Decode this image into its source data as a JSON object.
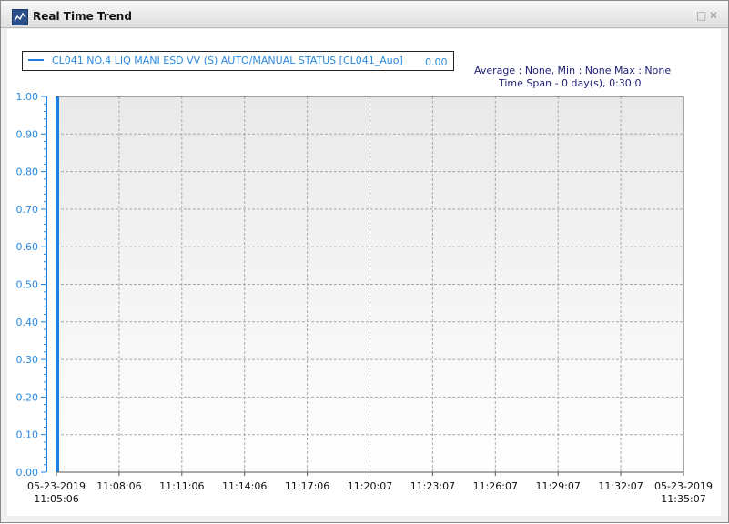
{
  "window": {
    "title": "Real Time Trend",
    "restore_symbol": "□",
    "close_symbol": "✕"
  },
  "legend": {
    "label": "CL041 NO.4 LIQ MANI ESD VV (S) AUTO/MANUAL STATUS [CL041_Auo]",
    "current_value": "0.00"
  },
  "stats": {
    "summary": "Average : None, Min : None Max : None",
    "time_span": "Time Span - 0 day(s),  0:30:0"
  },
  "colors": {
    "series": "#1f7fe0",
    "axis_text": "#2b8ae0",
    "stats_text": "#1e1e78"
  },
  "chart_data": {
    "type": "line",
    "title": "",
    "xlabel": "",
    "ylabel": "",
    "ylim": [
      0,
      1
    ],
    "yticks": [
      "0.00",
      "0.10",
      "0.20",
      "0.30",
      "0.40",
      "0.50",
      "0.60",
      "0.70",
      "0.80",
      "0.90",
      "1.00"
    ],
    "xticks": [
      {
        "line1": "05-23-2019",
        "line2": "11:05:06"
      },
      {
        "line1": "11:08:06",
        "line2": ""
      },
      {
        "line1": "11:11:06",
        "line2": ""
      },
      {
        "line1": "11:14:06",
        "line2": ""
      },
      {
        "line1": "11:17:06",
        "line2": ""
      },
      {
        "line1": "11:20:07",
        "line2": ""
      },
      {
        "line1": "11:23:07",
        "line2": ""
      },
      {
        "line1": "11:26:07",
        "line2": ""
      },
      {
        "line1": "11:29:07",
        "line2": ""
      },
      {
        "line1": "11:32:07",
        "line2": ""
      },
      {
        "line1": "05-23-2019",
        "line2": "11:35:07"
      }
    ],
    "grid": true,
    "series": [
      {
        "name": "CL041 NO.4 LIQ MANI ESD VV (S) AUTO/MANUAL STATUS [CL041_Auo]",
        "color": "#1f7fe0",
        "x": [
          0,
          0
        ],
        "y": [
          0.0,
          1.0
        ]
      }
    ]
  }
}
